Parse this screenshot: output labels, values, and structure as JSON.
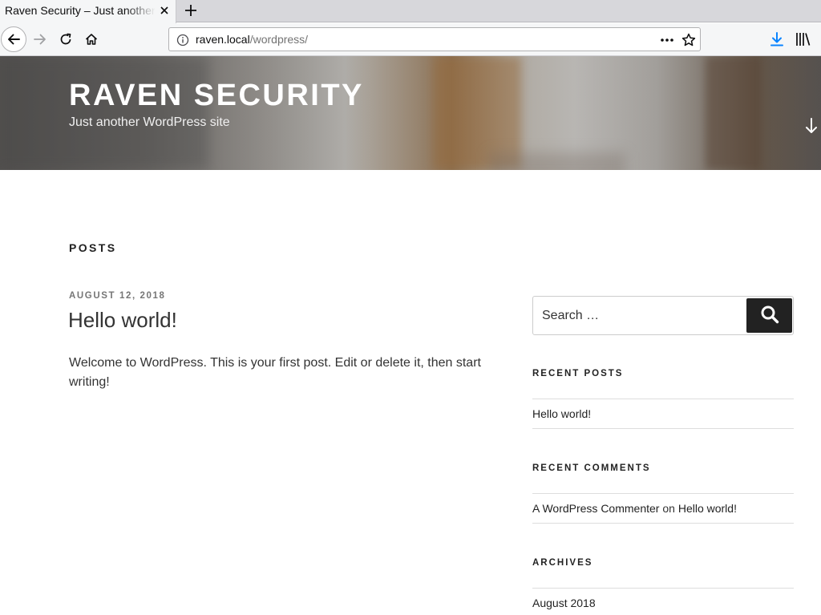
{
  "browser": {
    "tab_title": "Raven Security – Just another WordPress site",
    "url_host": "raven.local",
    "url_path": "/wordpress/",
    "icons": {
      "back": "arrow-left-icon",
      "forward": "arrow-right-icon",
      "reload": "reload-icon",
      "home": "home-icon",
      "info": "info-icon",
      "page_actions": "ellipsis-icon",
      "bookmark": "star-icon",
      "downloads": "download-icon",
      "library": "library-icon",
      "new_tab": "plus-icon",
      "close_tab": "close-icon"
    },
    "accent_color": "#0a84ff"
  },
  "header": {
    "site_title": "Raven Security",
    "site_description": "Just another WordPress site",
    "scroll_icon": "arrow-down-icon"
  },
  "main": {
    "page_title": "Posts",
    "posts": [
      {
        "date": "August 12, 2018",
        "title": "Hello world!",
        "excerpt": "Welcome to WordPress. This is your first post. Edit or delete it, then start writing!"
      }
    ]
  },
  "sidebar": {
    "search": {
      "placeholder": "Search …",
      "button_icon": "search-icon"
    },
    "recent_posts": {
      "title": "Recent Posts",
      "items": [
        "Hello world!"
      ]
    },
    "recent_comments": {
      "title": "Recent Comments",
      "items": [
        {
          "author": "A WordPress Commenter",
          "joiner": "on",
          "post": "Hello world!"
        }
      ]
    },
    "archives": {
      "title": "Archives",
      "items": [
        "August 2018"
      ]
    }
  }
}
